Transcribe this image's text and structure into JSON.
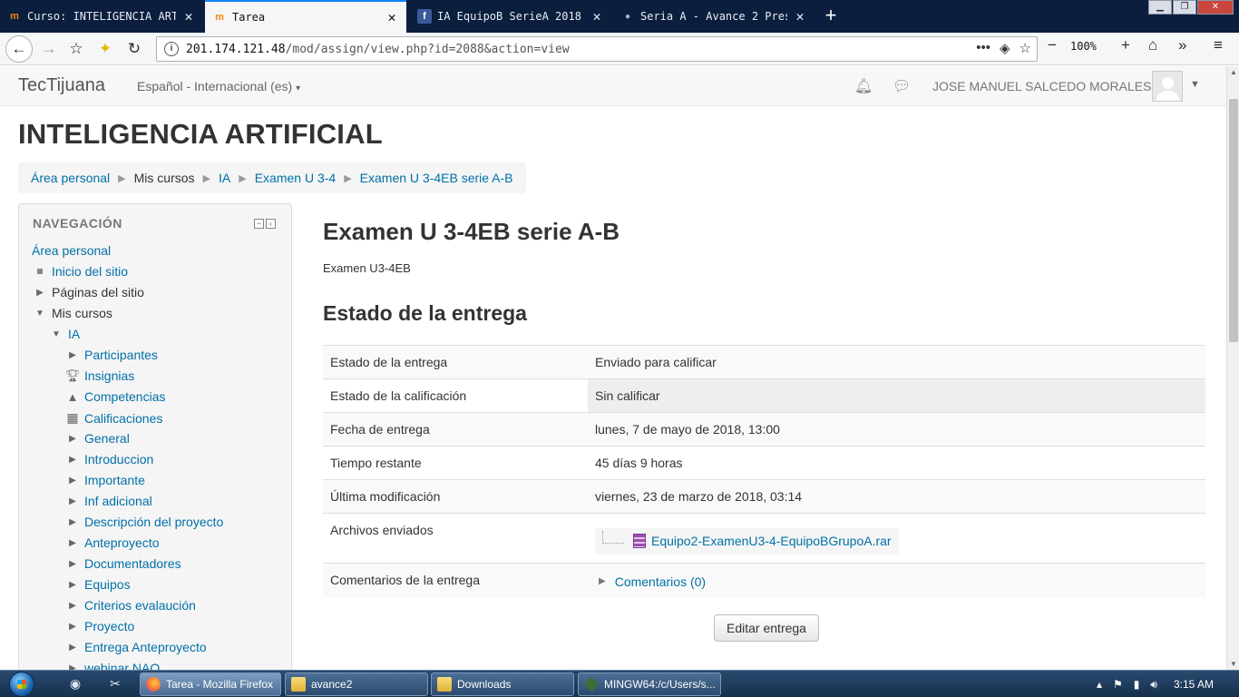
{
  "browser": {
    "tabs": [
      {
        "label": "Curso: INTELIGENCIA ARTIF",
        "icon": "moodle-icon",
        "active": false
      },
      {
        "label": "Tarea",
        "icon": "moodle-icon",
        "active": true
      },
      {
        "label": "IA EquipoB SerieA 2018",
        "icon": "facebook-icon",
        "active": false
      },
      {
        "label": "Seria A - Avance 2 Pres",
        "icon": "dot-icon",
        "active": false
      }
    ],
    "new_tab_symbol": "+",
    "url_host": "201.174.121.48",
    "url_path": "/mod/assign/view.php?id=2088&action=view",
    "zoom": "100%"
  },
  "header": {
    "brand": "TecTijuana",
    "language": "Español - Internacional (es)",
    "user_name": "JOSE MANUEL SALCEDO MORALES"
  },
  "page": {
    "course_title": "INTELIGENCIA ARTIFICIAL",
    "breadcrumb": [
      "Área personal",
      "Mis cursos",
      "IA",
      "Examen U 3-4",
      "Examen U 3-4EB serie A-B"
    ]
  },
  "navigation": {
    "heading": "NAVEGACIÓN",
    "items": [
      {
        "label": "Área personal",
        "kind": "link",
        "icon": "none"
      },
      {
        "label": "Inicio del sitio",
        "kind": "link",
        "icon": "bullet-icon"
      },
      {
        "label": "Páginas del sitio",
        "kind": "text",
        "icon": "expand-arrow-icon"
      },
      {
        "label": "Mis cursos",
        "kind": "text",
        "icon": "collapse-arrow-icon"
      },
      {
        "label": "IA",
        "kind": "link",
        "icon": "collapse-arrow-icon"
      },
      {
        "label": "Participantes",
        "kind": "link",
        "icon": "expand-arrow-icon"
      },
      {
        "label": "Insignias",
        "kind": "link",
        "icon": "trophy-icon"
      },
      {
        "label": "Competencias",
        "kind": "link",
        "icon": "competency-icon"
      },
      {
        "label": "Calificaciones",
        "kind": "link",
        "icon": "grades-table-icon"
      },
      {
        "label": "General",
        "kind": "link",
        "icon": "expand-arrow-icon"
      },
      {
        "label": "Introduccion",
        "kind": "link",
        "icon": "expand-arrow-icon"
      },
      {
        "label": "Importante",
        "kind": "link",
        "icon": "expand-arrow-icon"
      },
      {
        "label": "Inf adicional",
        "kind": "link",
        "icon": "expand-arrow-icon"
      },
      {
        "label": "Descripción del proyecto",
        "kind": "link",
        "icon": "expand-arrow-icon"
      },
      {
        "label": "Anteproyecto",
        "kind": "link",
        "icon": "expand-arrow-icon"
      },
      {
        "label": "Documentadores",
        "kind": "link",
        "icon": "expand-arrow-icon"
      },
      {
        "label": "Equipos",
        "kind": "link",
        "icon": "expand-arrow-icon"
      },
      {
        "label": "Criterios evalaución",
        "kind": "link",
        "icon": "expand-arrow-icon"
      },
      {
        "label": "Proyecto",
        "kind": "link",
        "icon": "expand-arrow-icon"
      },
      {
        "label": "Entrega Anteproyecto",
        "kind": "link",
        "icon": "expand-arrow-icon"
      },
      {
        "label": "webinar NAO",
        "kind": "link",
        "icon": "expand-arrow-icon"
      }
    ]
  },
  "assignment": {
    "title": "Examen U 3-4EB serie A-B",
    "description": "Examen U3-4EB",
    "status_heading": "Estado de la entrega",
    "rows": [
      {
        "key": "Estado de la entrega",
        "value": "Enviado para calificar"
      },
      {
        "key": "Estado de la calificación",
        "value": "Sin calificar"
      },
      {
        "key": "Fecha de entrega",
        "value": "lunes, 7 de mayo de 2018, 13:00"
      },
      {
        "key": "Tiempo restante",
        "value": "45 días 9 horas"
      },
      {
        "key": "Última modificación",
        "value": "viernes, 23 de marzo de 2018, 03:14"
      }
    ],
    "files_label": "Archivos enviados",
    "file_name": "Equipo2-ExamenU3-4-EquipoBGrupoA.rar",
    "comments_label": "Comentarios de la entrega",
    "comments_link": "Comentarios (0)",
    "edit_button": "Editar entrega"
  },
  "taskbar": {
    "tasks": [
      {
        "label": "Tarea - Mozilla Firefox",
        "icon": "firefox-icon",
        "active": true
      },
      {
        "label": "avance2",
        "icon": "folder-icon",
        "active": false
      },
      {
        "label": "Downloads",
        "icon": "folder-icon",
        "active": false
      },
      {
        "label": "MINGW64:/c/Users/s...",
        "icon": "git-icon",
        "active": false
      }
    ],
    "clock": "3:15 AM"
  },
  "colors": {
    "link": "#0070a8",
    "accent_tab": "#0a84ff",
    "tabstrip": "#0b1e3d"
  }
}
